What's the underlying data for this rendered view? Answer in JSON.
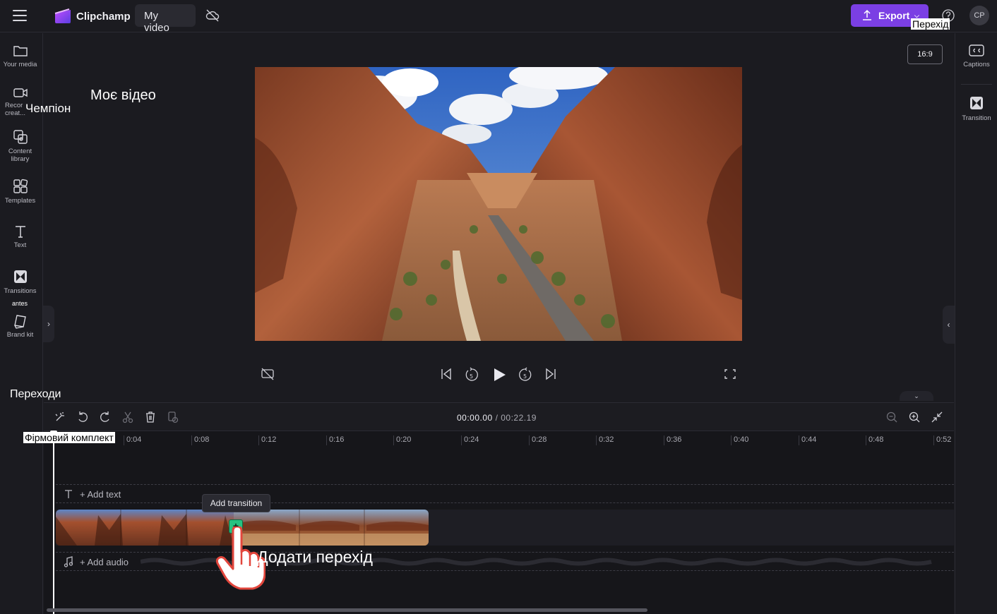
{
  "topbar": {
    "app_name": "Clipchamp",
    "video_name": "My video",
    "export_label": "Export",
    "avatar_initials": "CP"
  },
  "left_sidebar": {
    "items": [
      {
        "label": "Your media",
        "icon": "folder-icon"
      },
      {
        "label": "Record & create",
        "icon": "camera-icon"
      },
      {
        "label": "Content library",
        "icon": "library-icon"
      },
      {
        "label": "Templates",
        "icon": "templates-icon"
      },
      {
        "label": "Text",
        "icon": "text-icon"
      },
      {
        "label": "Transitions",
        "icon": "transition-icon"
      },
      {
        "label": "Brand kit",
        "icon": "brand-kit-icon"
      }
    ],
    "record_label_line1": "Recor",
    "record_label_line2": "creat..."
  },
  "right_sidebar": {
    "items": [
      {
        "label": "Captions",
        "icon": "captions-icon"
      },
      {
        "label": "Transition",
        "icon": "transition-icon"
      }
    ]
  },
  "preview": {
    "aspect_ratio": "16:9"
  },
  "overlays": {
    "title": "Моє відео",
    "champion": "Чемпіон",
    "transitions": "Переходи",
    "antes": "antes",
    "perexid": "Перехід",
    "brand_kit": "Фірмовий комплект",
    "add_transition": "Додати перехід"
  },
  "timeline": {
    "current_time": "00:00.00",
    "total_time": "/ 00:22.19",
    "ticks": [
      "0:04",
      "0:08",
      "0:12",
      "0:16",
      "0:20",
      "0:24",
      "0:28",
      "0:32",
      "0:36",
      "0:40",
      "0:44",
      "0:48",
      "0:52"
    ],
    "add_text_label": "+ Add text",
    "add_audio_label": "+ Add audio",
    "tooltip": "Add transition",
    "add_transition_symbol": "+"
  },
  "colors": {
    "accent": "#7b3fe4",
    "transition_button": "#26c281"
  }
}
